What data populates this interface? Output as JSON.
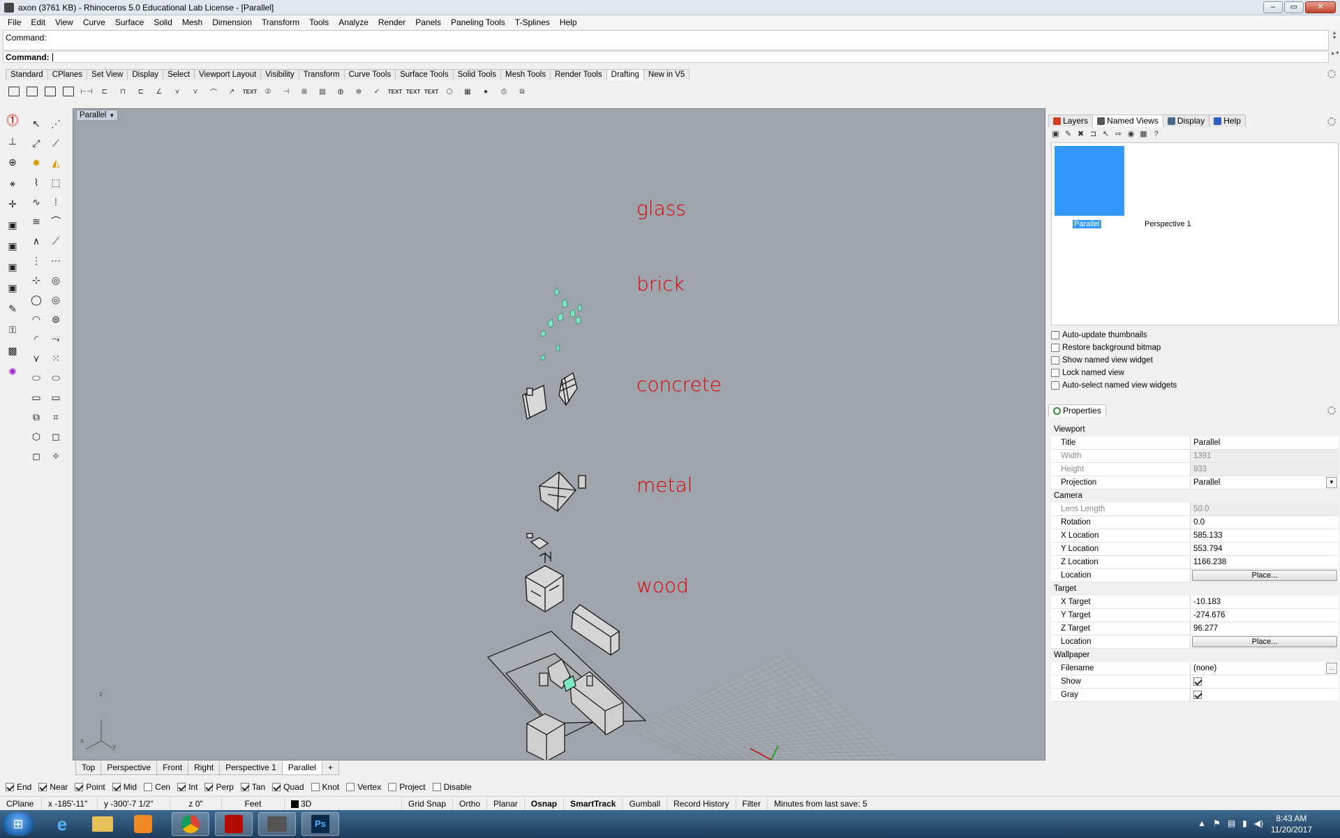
{
  "window": {
    "title": "axon (3761 KB) - Rhinoceros 5.0 Educational Lab License - [Parallel]",
    "min": "–",
    "max": "▭",
    "close": "✕"
  },
  "menu": [
    "File",
    "Edit",
    "View",
    "Curve",
    "Surface",
    "Solid",
    "Mesh",
    "Dimension",
    "Transform",
    "Tools",
    "Analyze",
    "Render",
    "Panels",
    "Paneling Tools",
    "T-Splines",
    "Help"
  ],
  "command": {
    "history": "Command:",
    "prompt": "Command:"
  },
  "toolbar_tabs": [
    "Standard",
    "CPlanes",
    "Set View",
    "Display",
    "Select",
    "Viewport Layout",
    "Visibility",
    "Transform",
    "Curve Tools",
    "Surface Tools",
    "Solid Tools",
    "Mesh Tools",
    "Render Tools",
    "Drafting",
    "New in V5"
  ],
  "toolbar_active": "Drafting",
  "viewport": {
    "title": "Parallel",
    "labels": [
      "glass",
      "brick",
      "concrete",
      "metal",
      "wood"
    ],
    "axes": {
      "x": "x",
      "y": "y",
      "z": "z"
    }
  },
  "view_tabs": [
    "Top",
    "Perspective",
    "Front",
    "Right",
    "Perspective 1",
    "Parallel"
  ],
  "view_tab_active": "Parallel",
  "view_tab_add": "+",
  "osnaps": [
    {
      "label": "End",
      "on": true
    },
    {
      "label": "Near",
      "on": true
    },
    {
      "label": "Point",
      "on": true
    },
    {
      "label": "Mid",
      "on": true
    },
    {
      "label": "Cen",
      "on": false
    },
    {
      "label": "Int",
      "on": true
    },
    {
      "label": "Perp",
      "on": true
    },
    {
      "label": "Tan",
      "on": true
    },
    {
      "label": "Quad",
      "on": true
    },
    {
      "label": "Knot",
      "on": false
    },
    {
      "label": "Vertex",
      "on": false
    },
    {
      "label": "Project",
      "on": false
    },
    {
      "label": "Disable",
      "on": false
    }
  ],
  "status": {
    "cplane": "CPlane",
    "x": "x -185'-11\"",
    "y": "y -300'-7 1/2\"",
    "z": "z 0\"",
    "units": "Feet",
    "layer": "3D",
    "grid_snap": "Grid Snap",
    "ortho": "Ortho",
    "planar": "Planar",
    "osnap": "Osnap",
    "smarttrack": "SmartTrack",
    "gumball": "Gumball",
    "record_history": "Record History",
    "filter": "Filter",
    "save": "Minutes from last save: 5"
  },
  "panel_tabs": [
    "Layers",
    "Named Views",
    "Display",
    "Help"
  ],
  "panel_tab_active": "Named Views",
  "named_views": {
    "views": [
      "Parallel",
      "Perspective 1"
    ],
    "options": [
      "Auto-update thumbnails",
      "Restore background bitmap",
      "Show named view widget",
      "Lock named view",
      "Auto-select named view widgets"
    ]
  },
  "properties": {
    "header": "Properties",
    "viewport": {
      "section": "Viewport",
      "title_k": "Title",
      "title_v": "Parallel",
      "width_k": "Width",
      "width_v": "1391",
      "height_k": "Height",
      "height_v": "933",
      "proj_k": "Projection",
      "proj_v": "Parallel"
    },
    "camera": {
      "section": "Camera",
      "lens_k": "Lens Length",
      "lens_v": "50.0",
      "rot_k": "Rotation",
      "rot_v": "0.0",
      "xl_k": "X Location",
      "xl_v": "585.133",
      "yl_k": "Y Location",
      "yl_v": "553.794",
      "zl_k": "Z Location",
      "zl_v": "1166.238",
      "loc_k": "Location",
      "loc_btn": "Place..."
    },
    "target": {
      "section": "Target",
      "xt_k": "X Target",
      "xt_v": "-10.183",
      "yt_k": "Y Target",
      "yt_v": "-274.676",
      "zt_k": "Z Target",
      "zt_v": "96.277",
      "loc_k": "Location",
      "loc_btn": "Place..."
    },
    "wallpaper": {
      "section": "Wallpaper",
      "file_k": "Filename",
      "file_v": "(none)",
      "file_btn": "...",
      "show_k": "Show",
      "gray_k": "Gray"
    }
  },
  "clock": {
    "time": "8:43 AM",
    "date": "11/20/2017"
  },
  "colors": {
    "accent": "#3399ff",
    "label_red": "#e00000",
    "viewport_bg": "#9da4ab"
  }
}
